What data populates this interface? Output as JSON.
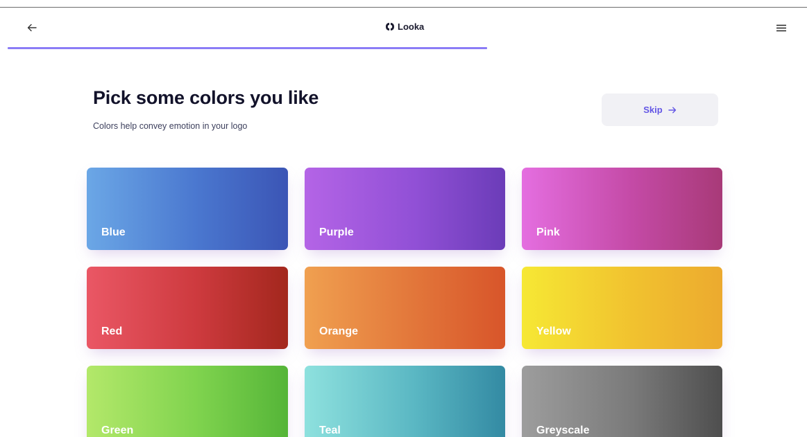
{
  "header": {
    "back_icon": "arrow-left-icon",
    "logo_text": "Looka",
    "logo_icon": "looka-logo-icon",
    "menu_icon": "hamburger-menu-icon"
  },
  "progress": {
    "fraction": 0.6,
    "color": "#8b7cf6"
  },
  "main": {
    "title": "Pick some colors you like",
    "subtitle": "Colors help convey emotion in your logo",
    "skip_label": "Skip",
    "skip_icon": "arrow-right-icon",
    "swatches": [
      {
        "label": "Blue",
        "key": "blue"
      },
      {
        "label": "Purple",
        "key": "purple"
      },
      {
        "label": "Pink",
        "key": "pink"
      },
      {
        "label": "Red",
        "key": "red"
      },
      {
        "label": "Orange",
        "key": "orange"
      },
      {
        "label": "Yellow",
        "key": "yellow"
      },
      {
        "label": "Green",
        "key": "green"
      },
      {
        "label": "Teal",
        "key": "teal"
      },
      {
        "label": "Greyscale",
        "key": "greyscale"
      }
    ]
  },
  "colors": {
    "accent": "#6356e5",
    "title_text": "#12122a",
    "skip_bg": "#f1f1f5"
  }
}
